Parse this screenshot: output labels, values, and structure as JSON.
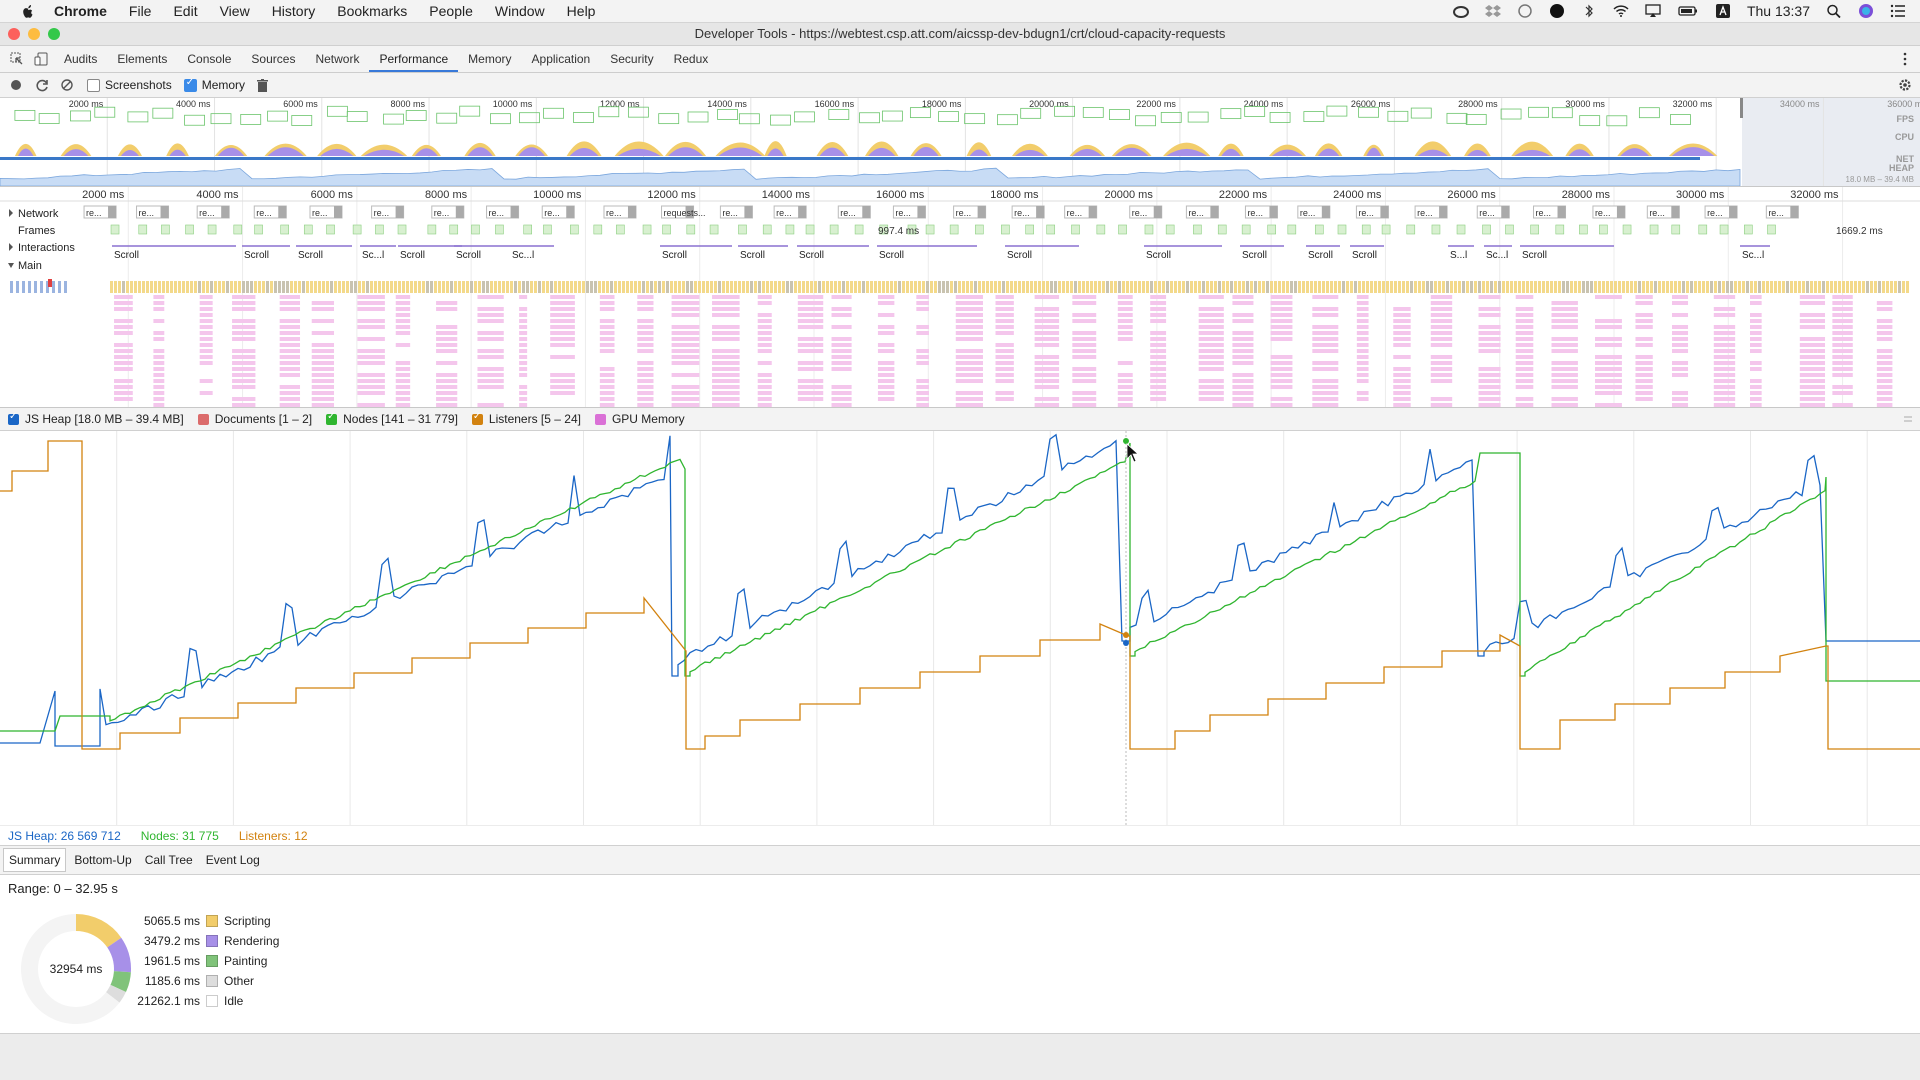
{
  "mac_menubar": {
    "items": [
      "Chrome",
      "File",
      "Edit",
      "View",
      "History",
      "Bookmarks",
      "People",
      "Window",
      "Help"
    ],
    "clock": "Thu 13:37"
  },
  "window": {
    "title": "Developer Tools - https://webtest.csp.att.com/aicssp-dev-bdugn1/crt/cloud-capacity-requests"
  },
  "devtools_tabs": [
    "Audits",
    "Elements",
    "Console",
    "Sources",
    "Network",
    "Performance",
    "Memory",
    "Application",
    "Security",
    "Redux"
  ],
  "active_tab": "Performance",
  "toolbar": {
    "screenshots_label": "Screenshots",
    "screenshots_checked": false,
    "memory_label": "Memory",
    "memory_checked": true
  },
  "overview": {
    "ticks": [
      "2000 ms",
      "4000 ms",
      "6000 ms",
      "8000 ms",
      "10000 ms",
      "12000 ms",
      "14000 ms",
      "16000 ms",
      "18000 ms",
      "20000 ms",
      "22000 ms",
      "24000 ms",
      "26000 ms",
      "28000 ms",
      "30000 ms",
      "32000 ms",
      "34000 ms",
      "36000 ms"
    ],
    "labels": [
      "FPS",
      "CPU",
      "NET",
      "HEAP"
    ],
    "heap_range": "18.0 MB – 39.4 MB"
  },
  "timeline": {
    "ticks": [
      "2000 ms",
      "4000 ms",
      "6000 ms",
      "8000 ms",
      "10000 ms",
      "12000 ms",
      "14000 ms",
      "16000 ms",
      "18000 ms",
      "20000 ms",
      "22000 ms",
      "24000 ms",
      "26000 ms",
      "28000 ms",
      "30000 ms",
      "32000 ms"
    ],
    "tracks": {
      "network": "Network",
      "frames": "Frames",
      "interactions": "Interactions",
      "main": "Main"
    },
    "network_request_label": "requests...",
    "network_short_label": "re...",
    "frame_labels": [
      "997.4 ms",
      "1669.2 ms"
    ],
    "interaction_labels": [
      "Scroll",
      "Scroll",
      "Scroll",
      "Sc...l",
      "Scroll",
      "Scroll",
      "Sc...l",
      "Scroll",
      "Scroll",
      "Scroll",
      "Scroll",
      "Scroll",
      "Scroll",
      "Scroll",
      "Scroll",
      "Scroll",
      "S...l",
      "Sc...l",
      "Scroll",
      "Sc...l"
    ]
  },
  "legend": [
    {
      "label": "JS Heap [18.0 MB – 39.4 MB]",
      "color": "#1a66c6",
      "checked": true
    },
    {
      "label": "Documents [1 – 2]",
      "color": "#db6b6b",
      "checked": false
    },
    {
      "label": "Nodes [141 – 31 779]",
      "color": "#2fb52f",
      "checked": true
    },
    {
      "label": "Listeners [5 – 24]",
      "color": "#d2820f",
      "checked": true
    },
    {
      "label": "GPU Memory",
      "color": "#da70d6",
      "checked": false
    }
  ],
  "counter_stats": {
    "js_heap": "JS Heap: 26 569 712",
    "nodes": "Nodes: 31 775",
    "listeners": "Listeners: 12"
  },
  "sub_tabs": [
    "Summary",
    "Bottom-Up",
    "Call Tree",
    "Event Log"
  ],
  "summary": {
    "range": "Range: 0 – 32.95 s",
    "total": "32954 ms",
    "rows": [
      {
        "value": "5065.5 ms",
        "label": "Scripting",
        "color": "#f2cd6b"
      },
      {
        "value": "3479.2 ms",
        "label": "Rendering",
        "color": "#a790e8"
      },
      {
        "value": "1961.5 ms",
        "label": "Painting",
        "color": "#80c37a"
      },
      {
        "value": "1185.6 ms",
        "label": "Other",
        "color": "#dddddd"
      },
      {
        "value": "21262.1 ms",
        "label": "Idle",
        "color": "#ffffff"
      }
    ]
  },
  "chart_data": {
    "type": "line",
    "x_unit": "ms",
    "xlim": [
      0,
      32950
    ],
    "series": [
      {
        "name": "JS Heap",
        "color": "#1a66c6",
        "range": "18.0 MB – 39.4 MB"
      },
      {
        "name": "Nodes",
        "color": "#2fb52f",
        "range": "141 – 31 779"
      },
      {
        "name": "Listeners",
        "color": "#d2820f",
        "range": "5 – 24"
      }
    ]
  }
}
